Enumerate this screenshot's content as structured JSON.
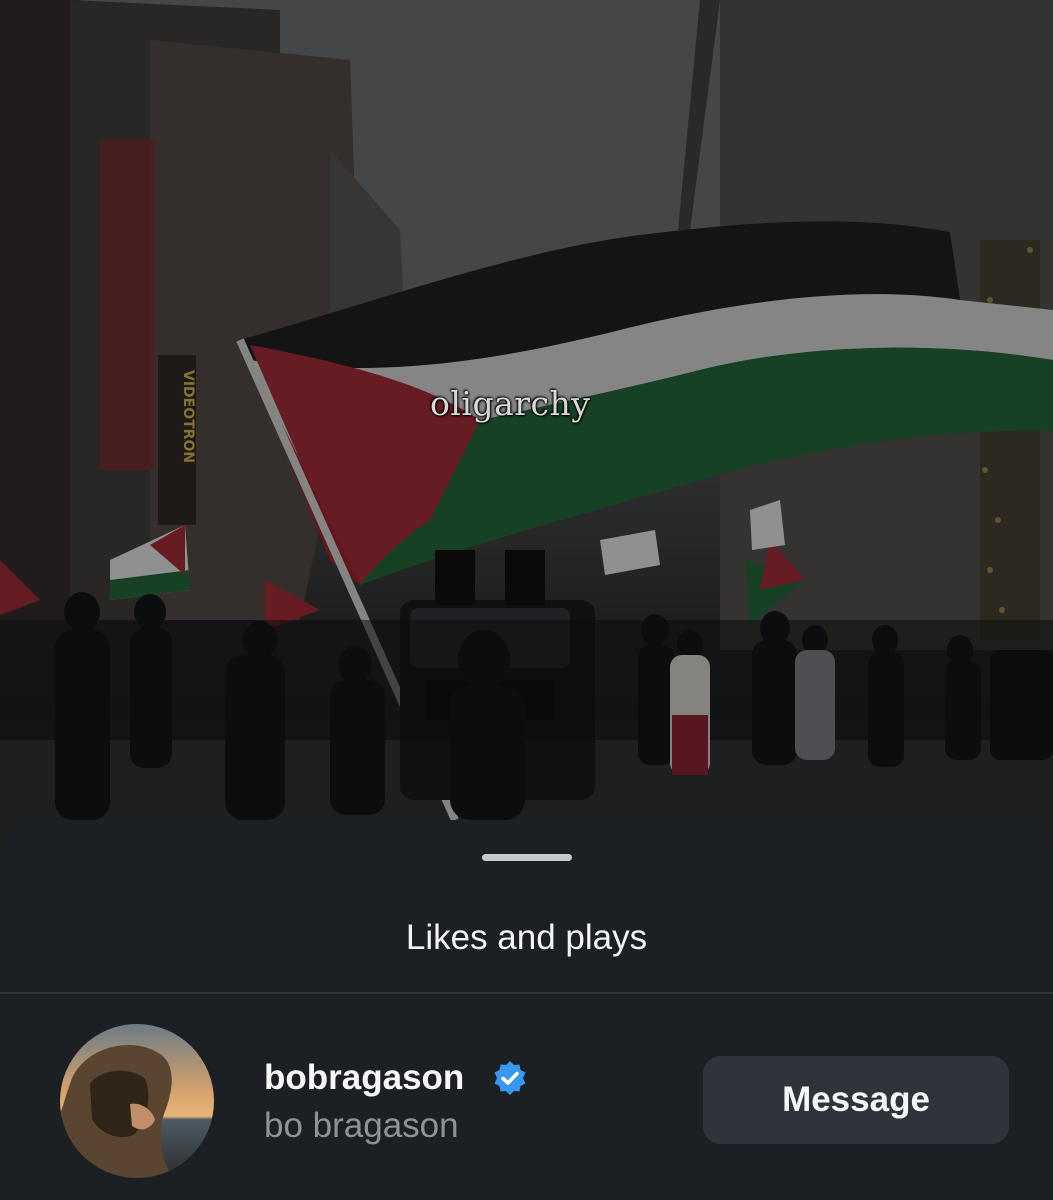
{
  "video": {
    "caption": "oligarchy",
    "signs": {
      "vertical_sign": "VIDEOTRON"
    },
    "colors": {
      "flag_black": "#1a1a1a",
      "flag_white": "#d9d9d9",
      "flag_green": "#1f6b3a",
      "flag_red": "#b3242f"
    }
  },
  "sheet": {
    "title": "Likes and plays",
    "user": {
      "username": "bobragason",
      "full_name": "bo bragason",
      "verified": true,
      "message_label": "Message"
    }
  },
  "theme": {
    "sheet_bg": "#1c2025",
    "button_bg": "#2f343b",
    "verified_blue": "#3897f0"
  }
}
